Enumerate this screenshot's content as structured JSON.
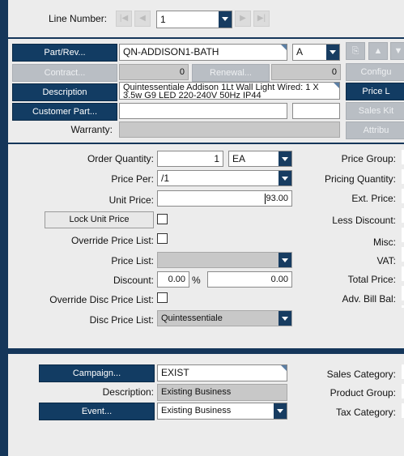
{
  "header": {
    "line_number_label": "Line Number:",
    "line_number_value": "1"
  },
  "part": {
    "part_rev_label": "Part/Rev...",
    "part_value": "QN-ADDISON1-BATH",
    "rev_value": "A",
    "contract_label": "Contract...",
    "contract_value": "0",
    "renewal_label": "Renewal...",
    "renewal_value": "0",
    "description_label": "Description",
    "description_value": "Quintessentiale Addison 1Lt Wall Light Wired: 1 X 3.5w G9 LED 220-240V 50Hz IP44",
    "customer_part_label": "Customer Part...",
    "customer_part_value": "",
    "customer_part_rev": "",
    "warranty_label": "Warranty:",
    "warranty_value": ""
  },
  "side_buttons": {
    "configure_label": "Configu",
    "price_list_label": "Price L",
    "sales_kit_label": "Sales Kit",
    "attributes_label": "Attribu"
  },
  "pricing": {
    "order_quantity_label": "Order Quantity:",
    "order_quantity_value": "1",
    "uom_value": "EA",
    "price_per_label": "Price Per:",
    "price_per_value": "/1",
    "unit_price_label": "Unit Price:",
    "unit_price_value": "93.00",
    "lock_unit_price_label": "Lock Unit Price",
    "override_price_list_label": "Override Price List:",
    "price_list_label": "Price List:",
    "price_list_value": "",
    "discount_label": "Discount:",
    "discount_pct_value": "0.00",
    "discount_pct_symbol": "%",
    "discount_amount_value": "0.00",
    "override_disc_price_list_label": "Override Disc Price List:",
    "disc_price_list_label": "Disc Price List:",
    "disc_price_list_value": "Quintessentiale"
  },
  "right_labels": {
    "price_group": "Price Group:",
    "pricing_quantity": "Pricing Quantity:",
    "ext_price": "Ext. Price:",
    "less_discount": "Less Discount:",
    "misc": "Misc:",
    "vat": "VAT:",
    "total_price": "Total Price:",
    "adv_bill_bal": "Adv. Bill Bal:"
  },
  "campaign": {
    "campaign_label": "Campaign...",
    "campaign_value": "EXIST",
    "description_label": "Description:",
    "description_value": "Existing Business",
    "event_label": "Event...",
    "event_value": "Existing Business",
    "sales_category_label": "Sales Category:",
    "product_group_label": "Product Group:",
    "tax_category_label": "Tax Category:"
  },
  "colors": {
    "navy": "#123c63",
    "panel": "#ececec",
    "background": "#15365a"
  }
}
